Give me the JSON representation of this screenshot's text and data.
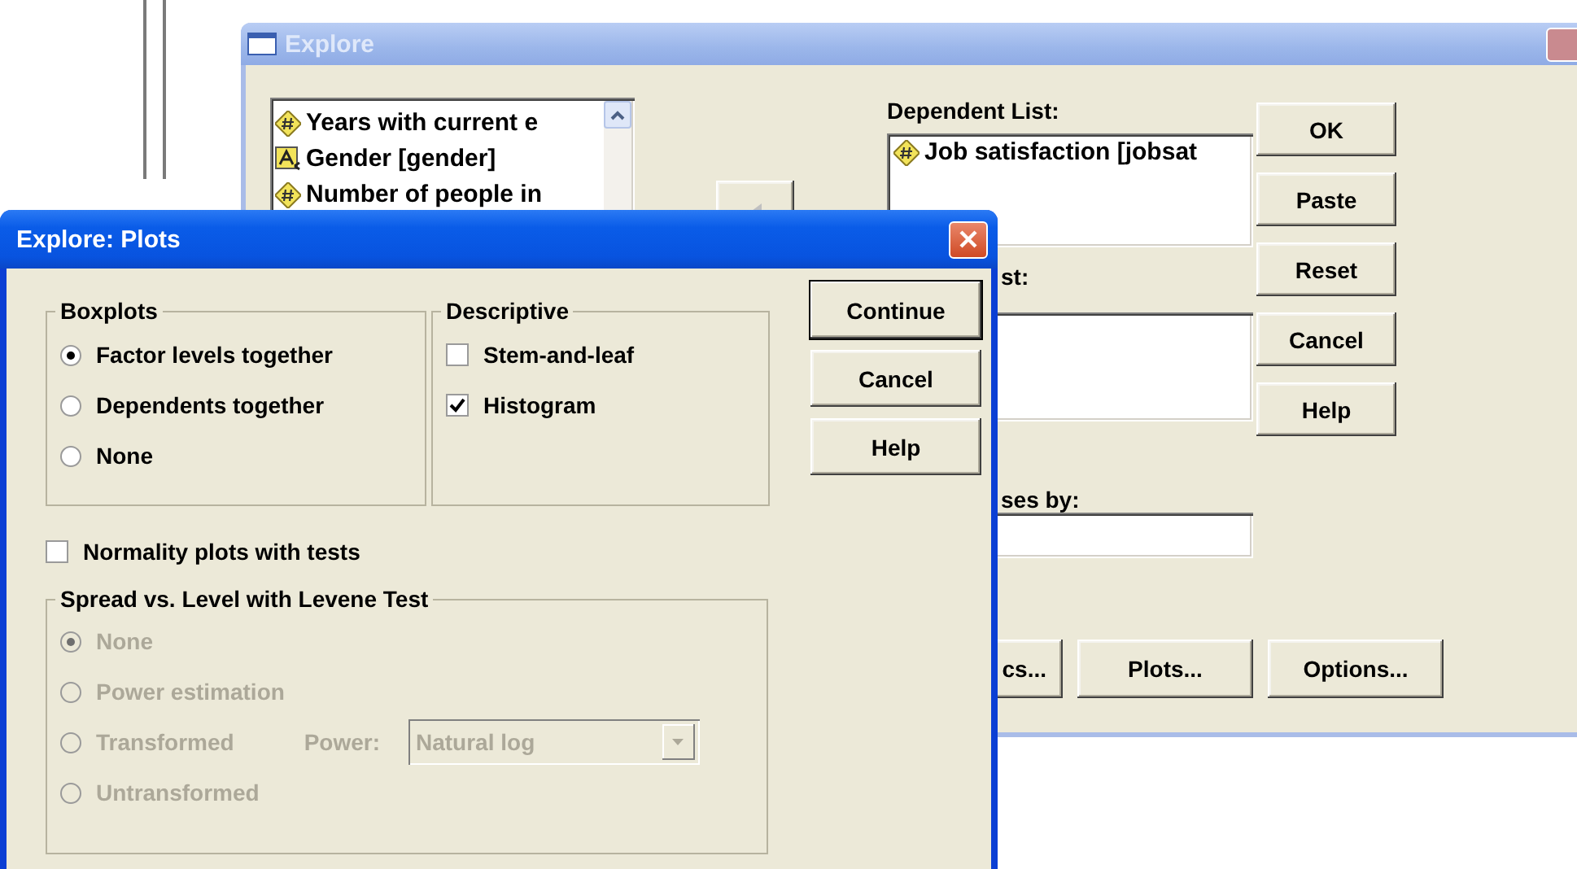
{
  "explore_window": {
    "title": "Explore",
    "variables": [
      {
        "label": "Years with current e",
        "kind": "scale"
      },
      {
        "label": "Gender [gender]",
        "kind": "nominal"
      },
      {
        "label": "Number of people in",
        "kind": "scale"
      }
    ],
    "dependent_list": {
      "label": "Dependent List:",
      "items": [
        {
          "label": "Job satisfaction [jobsat",
          "kind": "scale"
        }
      ]
    },
    "factor_list": {
      "label": "st:"
    },
    "label_cases": {
      "label": "ses by:"
    },
    "side_buttons": [
      {
        "label": "OK"
      },
      {
        "label": "Paste"
      },
      {
        "label": "Reset"
      },
      {
        "label": "Cancel"
      },
      {
        "label": "Help"
      }
    ],
    "bottom_buttons": [
      {
        "label": "cs..."
      },
      {
        "label": "Plots..."
      },
      {
        "label": "Options..."
      }
    ]
  },
  "plots_dialog": {
    "title": "Explore: Plots",
    "boxplots": {
      "title": "Boxplots",
      "options": [
        {
          "label": "Factor levels together",
          "selected": true
        },
        {
          "label": "Dependents together",
          "selected": false
        },
        {
          "label": "None",
          "selected": false
        }
      ]
    },
    "descriptive": {
      "title": "Descriptive",
      "options": [
        {
          "label": "Stem-and-leaf",
          "checked": false
        },
        {
          "label": "Histogram",
          "checked": true
        }
      ]
    },
    "buttons": [
      {
        "label": "Continue",
        "default": true
      },
      {
        "label": "Cancel",
        "default": false
      },
      {
        "label": "Help",
        "default": false
      }
    ],
    "normality": {
      "label": "Normality plots with tests",
      "checked": false
    },
    "spread": {
      "title": "Spread vs. Level with Levene Test",
      "options": [
        {
          "label": "None",
          "selected": true,
          "disabled": true
        },
        {
          "label": "Power estimation",
          "selected": false,
          "disabled": true
        },
        {
          "label": "Transformed",
          "selected": false,
          "disabled": true
        },
        {
          "label": "Untransformed",
          "selected": false,
          "disabled": true
        }
      ],
      "power": {
        "label": "Power:",
        "value": "Natural log",
        "disabled": true
      }
    }
  }
}
